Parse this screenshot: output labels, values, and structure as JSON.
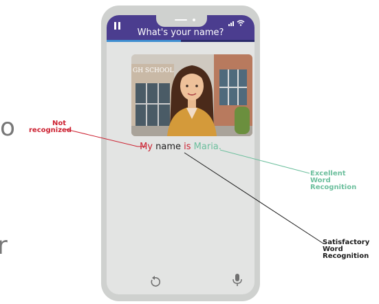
{
  "app": {
    "question_title": "What's your name?",
    "progress_fraction": 0.5
  },
  "scene": {
    "sign_text": "GH SCHOOL"
  },
  "sentence": {
    "w1": "My",
    "w2": "name",
    "w3": "is",
    "w4": "Maria."
  },
  "callouts": {
    "red_line1": "Not",
    "red_line2": "recognized",
    "green_line1": "Excellent",
    "green_line2": "Word",
    "green_line3": "Recognition",
    "black_line1": "Satisfactory",
    "black_line2": "Word",
    "black_line3": "Recognition"
  },
  "stray": {
    "left_glyph": "o",
    "left_glyph_2": "r"
  },
  "colors": {
    "header": "#4b3d8f",
    "not_recognized": "#cc2030",
    "excellent": "#6cbf9d",
    "satisfactory": "#1a1a1a",
    "phone_frame": "#cfd1cf"
  },
  "icons": {
    "pause": "pause-icon",
    "signal": "signal-icon",
    "wifi": "wifi-icon",
    "replay": "replay-icon",
    "mic": "microphone-icon"
  }
}
